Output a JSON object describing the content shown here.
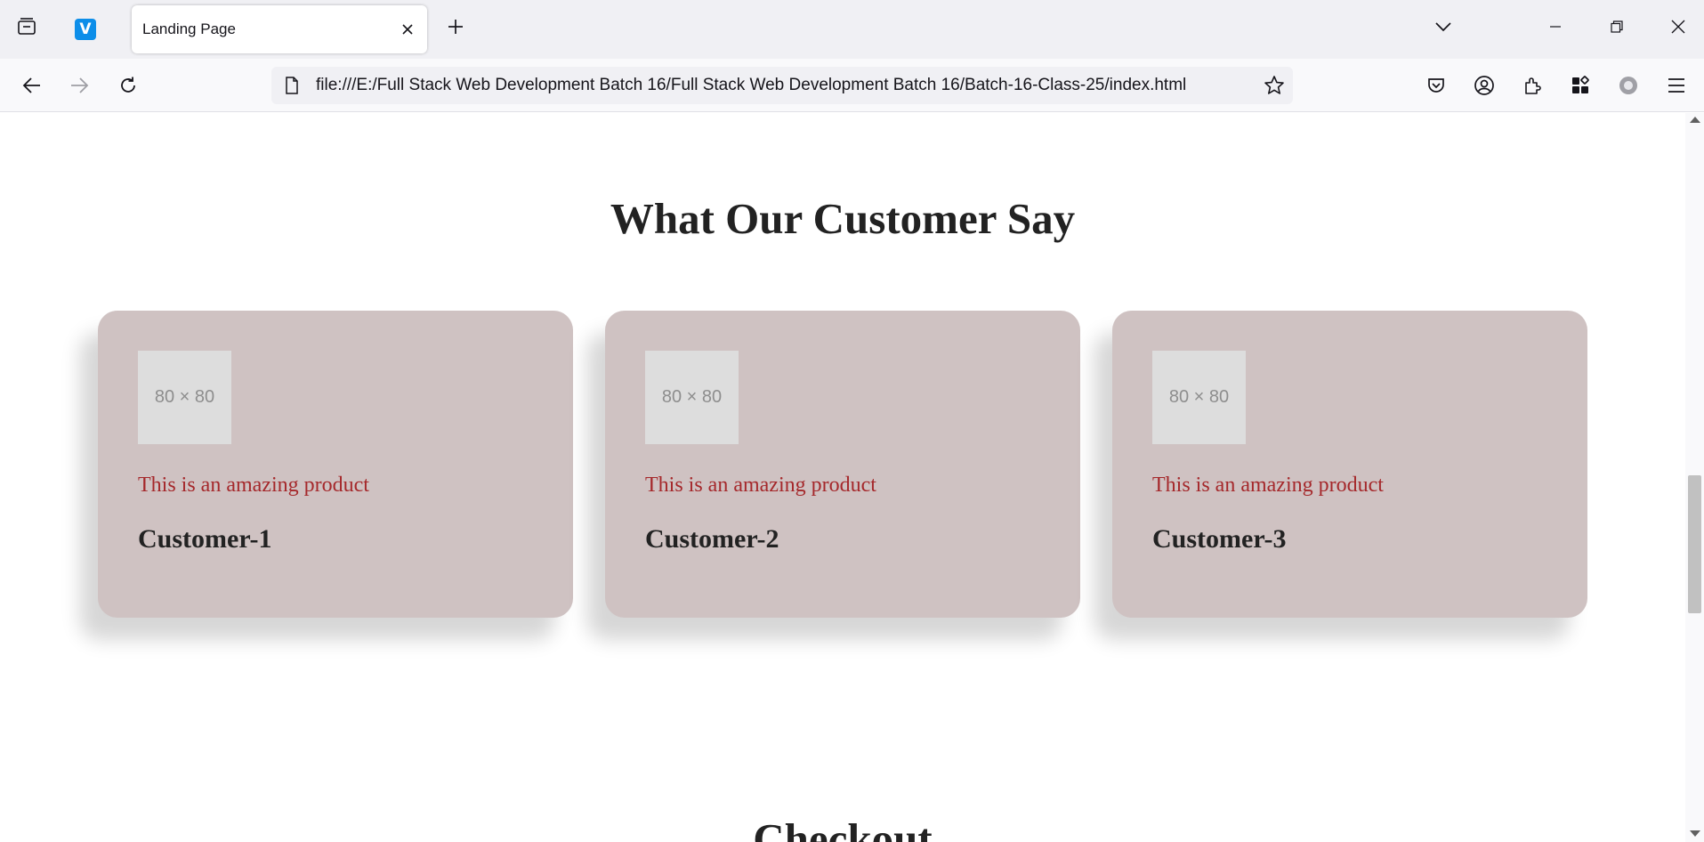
{
  "browser": {
    "tab_title": "Landing Page",
    "url": "file:///E:/Full Stack Web Development Batch 16/Full Stack Web Development Batch 16/Batch-16-Class-25/index.html",
    "pinned_tab_letter": "V",
    "icons": {
      "tab_manager": "tab-manager-icon",
      "new_tab": "plus-icon",
      "list_tabs": "chevron-down-icon",
      "back": "arrow-left-icon",
      "forward": "arrow-right-icon",
      "reload": "reload-icon",
      "page": "page-icon",
      "bookmark": "star-icon",
      "pocket": "pocket-icon",
      "account": "account-icon",
      "extensions": "puzzle-icon",
      "apps": "apps-icon",
      "profile": "circle-icon",
      "menu": "hamburger-icon"
    }
  },
  "page": {
    "section_title": "What Our Customer Say",
    "cards": [
      {
        "image_label": "80 × 80",
        "quote": "This is an amazing product",
        "name": "Customer-1"
      },
      {
        "image_label": "80 × 80",
        "quote": "This is an amazing product",
        "name": "Customer-2"
      },
      {
        "image_label": "80 × 80",
        "quote": "This is an amazing product",
        "name": "Customer-3"
      }
    ],
    "next_section_title": "Checkout"
  },
  "colors": {
    "card_background": "#cfc2c2",
    "quote_text": "#a5282b",
    "heading_text": "#222222",
    "placeholder_bg": "#dddddd"
  }
}
